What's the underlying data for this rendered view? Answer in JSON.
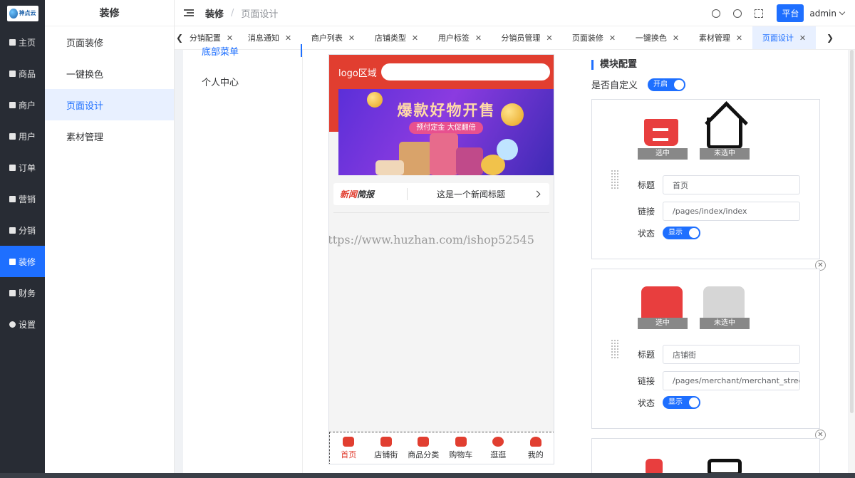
{
  "brand": {
    "logo_text": "神点云"
  },
  "rail": [
    {
      "label": "主页"
    },
    {
      "label": "商品"
    },
    {
      "label": "商户"
    },
    {
      "label": "用户"
    },
    {
      "label": "订单"
    },
    {
      "label": "营销"
    },
    {
      "label": "分销"
    },
    {
      "label": "装修"
    },
    {
      "label": "财务"
    },
    {
      "label": "设置"
    }
  ],
  "submenu": {
    "title": "装修",
    "items": [
      {
        "label": "页面装修"
      },
      {
        "label": "一键换色"
      },
      {
        "label": "页面设计"
      },
      {
        "label": "素材管理"
      }
    ]
  },
  "topbar": {
    "crumb_section": "装修",
    "crumb_page": "页面设计",
    "platform_button": "平台",
    "username": "admin"
  },
  "tabs": [
    {
      "label": "分销配置"
    },
    {
      "label": "消息通知"
    },
    {
      "label": "商户列表"
    },
    {
      "label": "店铺类型"
    },
    {
      "label": "用户标签"
    },
    {
      "label": "分销员管理"
    },
    {
      "label": "页面装修"
    },
    {
      "label": "一键换色"
    },
    {
      "label": "素材管理"
    },
    {
      "label": "页面设计"
    }
  ],
  "pages": [
    {
      "label": "底部菜单"
    },
    {
      "label": "个人中心"
    }
  ],
  "phone": {
    "logo_label": "logo区域",
    "banner_title": "爆款好物开售",
    "banner_subtitle": "预付定金 大促翻倍",
    "news_brand_red": "新闻",
    "news_brand_dark": "简报",
    "news_headline": "这是一个新闻标题",
    "watermark": "https://www.huzhan.com/ishop52545",
    "tabbar": [
      {
        "label": "首页"
      },
      {
        "label": "店铺街"
      },
      {
        "label": "商品分类"
      },
      {
        "label": "购物车"
      },
      {
        "label": "逛逛"
      },
      {
        "label": "我的"
      }
    ]
  },
  "config": {
    "title": "模块配置",
    "custom_label": "是否自定义",
    "custom_switch": "开启",
    "cards": [
      {
        "selected": "选中",
        "unselected": "未选中",
        "title_key": "标题",
        "title_value": "首页",
        "link_key": "链接",
        "link_value": "/pages/index/index",
        "status_key": "状态",
        "status_value": "显示"
      },
      {
        "selected": "选中",
        "unselected": "未选中",
        "title_key": "标题",
        "title_value": "店铺街",
        "link_key": "链接",
        "link_value": "/pages/merchant/merchant_street/i",
        "status_key": "状态",
        "status_value": "显示"
      }
    ]
  },
  "colors": {
    "accent": "#1e6fff",
    "brand_red": "#e13e30",
    "rail_bg": "#282c34"
  }
}
